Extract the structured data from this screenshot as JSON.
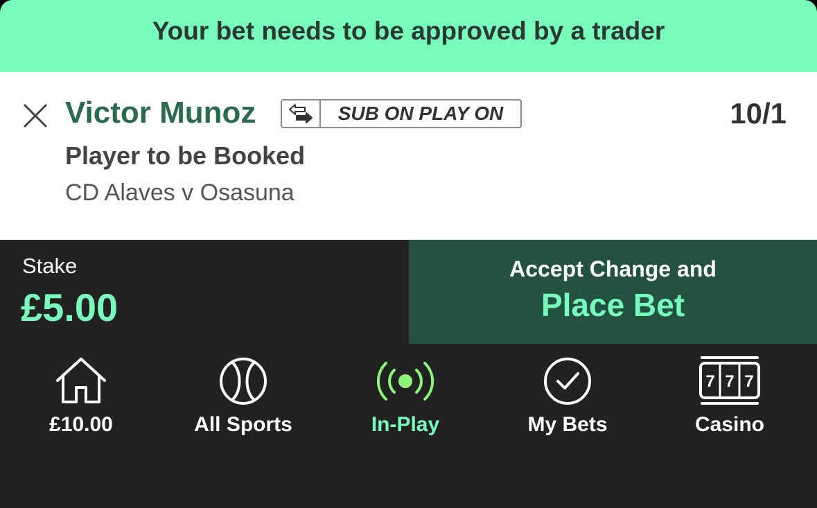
{
  "banner": {
    "message": "Your bet needs to be approved by a trader"
  },
  "selection": {
    "player": "Victor Munoz",
    "badge": "SUB ON PLAY ON",
    "odds": "10/1",
    "market": "Player to be Booked",
    "event": "CD Alaves v Osasuna"
  },
  "stake": {
    "label": "Stake",
    "value": "£5.00"
  },
  "place_bet": {
    "line1": "Accept Change and",
    "line2": "Place Bet"
  },
  "nav": {
    "items": [
      {
        "label": "£10.00",
        "icon": "home-icon"
      },
      {
        "label": "All Sports",
        "icon": "ball-icon"
      },
      {
        "label": "In-Play",
        "icon": "live-icon",
        "active": true
      },
      {
        "label": "My Bets",
        "icon": "check-circle-icon"
      },
      {
        "label": "Casino",
        "icon": "slot-machine-icon"
      }
    ]
  },
  "colors": {
    "banner": "#79fcbb",
    "brand_green": "#2a6a4e",
    "accent": "#79fcbb",
    "place_bet_bg": "#245240",
    "dark_bg": "#222222"
  }
}
